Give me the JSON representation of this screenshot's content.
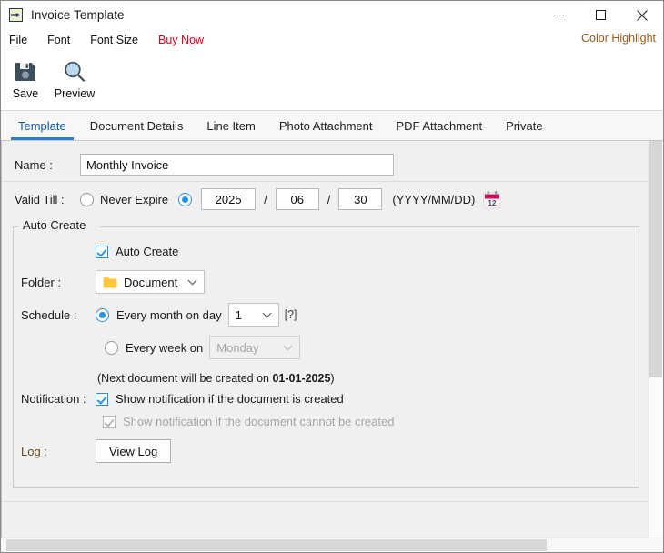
{
  "window": {
    "title": "Invoice Template",
    "icon": "document-export-icon",
    "minimize_label": "Minimize",
    "maximize_label": "Maximize",
    "close_label": "Close"
  },
  "menubar": {
    "items": [
      {
        "label": "File",
        "accel": "F"
      },
      {
        "label": "Font",
        "accel": "o"
      },
      {
        "label": "Font Size",
        "accel": "S"
      },
      {
        "label": "Buy Now",
        "accel": "o"
      }
    ],
    "color_highlight": "Color Highlight",
    "buy_now_color": "#e2001a",
    "color_highlight_color": "#9c5b16"
  },
  "toolbar": {
    "buttons": [
      {
        "label": "Save",
        "icon": "floppy-save-icon"
      },
      {
        "label": "Preview",
        "icon": "magnifier-preview-icon"
      }
    ]
  },
  "tabs": {
    "items": [
      {
        "label": "Template",
        "active": true
      },
      {
        "label": "Document Details",
        "active": false
      },
      {
        "label": "Line Item",
        "active": false
      },
      {
        "label": "Photo Attachment",
        "active": false
      },
      {
        "label": "PDF Attachment",
        "active": false
      },
      {
        "label": "Private",
        "active": false
      }
    ],
    "accent": "#2d7dd2"
  },
  "form": {
    "name": {
      "label": "Name :",
      "value": "Monthly Invoice",
      "placeholder": ""
    },
    "valid_till": {
      "label": "Valid Till :",
      "never_expire_label": "Never Expire",
      "never_expire_selected": false,
      "date_selected": true,
      "year": "2025",
      "month": "06",
      "day": "30",
      "separator": "/",
      "format_hint": "(YYYY/MM/DD)",
      "calendar_icon": "calendar-picker-icon",
      "calendar_day": "12"
    },
    "auto_create_group": {
      "title": "Auto Create",
      "checkbox_label": "Auto Create",
      "checkbox_checked": true,
      "folder": {
        "label": "Folder :",
        "value": "Document",
        "icon": "folder-icon",
        "folder_color": "#ffc83d"
      },
      "schedule": {
        "label": "Schedule :",
        "monthly": {
          "label": "Every month on day",
          "selected": true,
          "day_value": "1",
          "help": "[?]"
        },
        "weekly": {
          "label": "Every week on",
          "selected": false,
          "day_value": "Monday",
          "disabled": true
        },
        "next_doc_prefix": "(Next document will be created on ",
        "next_doc_date": "01-01-2025",
        "next_doc_suffix": ")"
      },
      "notification": {
        "label": "Notification :",
        "created": {
          "label": "Show notification if the document is created",
          "checked": true,
          "disabled": false
        },
        "cannot_create": {
          "label": "Show notification if the document cannot be created",
          "checked": true,
          "disabled": true
        }
      },
      "log": {
        "label": "Log :",
        "button_label": "View Log"
      }
    }
  },
  "scroll": {
    "vertical_position": "top",
    "horizontal_position": "left"
  }
}
